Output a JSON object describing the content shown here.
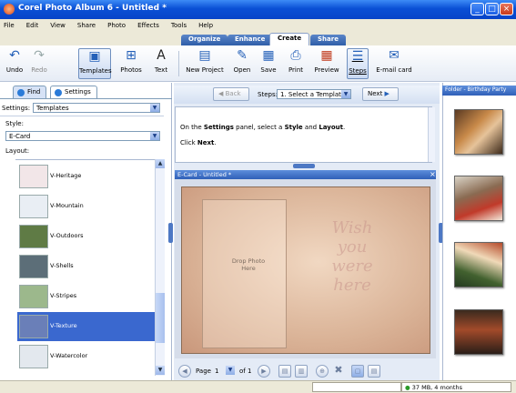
{
  "window": {
    "title": "Corel Photo Album 6 - Untitled *"
  },
  "menu": [
    "File",
    "Edit",
    "View",
    "Share",
    "Photo",
    "Effects",
    "Tools",
    "Help"
  ],
  "main_tabs": [
    {
      "label": "Organize",
      "active": false
    },
    {
      "label": "Enhance",
      "active": false
    },
    {
      "label": "Create",
      "active": true
    },
    {
      "label": "Share",
      "active": false
    }
  ],
  "toolbar": {
    "undo": "Undo",
    "redo": "Redo",
    "templates": "Templates",
    "photos": "Photos",
    "text": "Text",
    "new_project": "New Project",
    "open": "Open",
    "save": "Save",
    "print": "Print",
    "preview": "Preview",
    "steps": "Steps",
    "email": "E-mail card"
  },
  "left_panel": {
    "tab_find": "Find",
    "tab_settings": "Settings",
    "settings_label": "Settings:",
    "settings_value": "Templates",
    "style_label": "Style:",
    "style_value": "E-Card",
    "layout_label": "Layout:",
    "layouts": [
      {
        "name": "V-Heritage",
        "selected": false,
        "color": "#f2e6e8"
      },
      {
        "name": "V-Mountain",
        "selected": false,
        "color": "#e9eef4"
      },
      {
        "name": "V-Outdoors",
        "selected": false,
        "color": "#5f7b45"
      },
      {
        "name": "V-Shells",
        "selected": false,
        "color": "#5c6e78"
      },
      {
        "name": "V-Stripes",
        "selected": false,
        "color": "#9cb88c"
      },
      {
        "name": "V-Texture",
        "selected": true,
        "color": "#6a7fb8"
      },
      {
        "name": "V-Watercolor",
        "selected": false,
        "color": "#e3e8ee"
      }
    ]
  },
  "steps_bar": {
    "back": "Back",
    "steps_label": "Steps:",
    "step_value": "1.  Select a Template",
    "next": "Next"
  },
  "instructions": {
    "line1_a": "On the ",
    "line1_b": "Settings",
    "line1_c": " panel, select a ",
    "line1_d": "Style",
    "line1_e": " and ",
    "line1_f": "Layout",
    ".": ".",
    "line2_a": "Click ",
    "line2_b": "Next",
    "line2_c": "."
  },
  "canvas": {
    "window_title": "E-Card - Untitled *",
    "placeholder": "Drop Photo Here",
    "wish_text": [
      "Wish",
      "you",
      "were",
      "here"
    ]
  },
  "pager": {
    "page_label": "Page",
    "page_value": "1",
    "of_label": "of 1"
  },
  "right_panel": {
    "title": "Folder - Birthday Party"
  },
  "status": {
    "memory": "37 MB, 4 months"
  }
}
